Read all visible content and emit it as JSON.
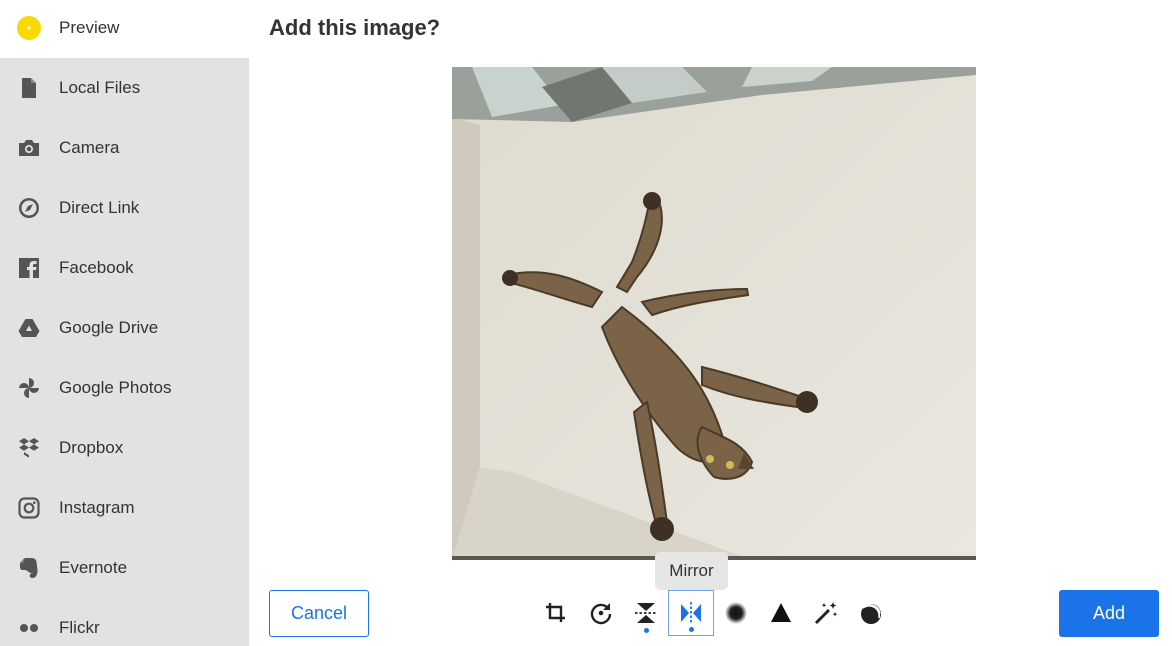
{
  "title": "Add this image?",
  "sidebar": {
    "items": [
      {
        "label": "Preview",
        "icon": "preview-dot-icon",
        "active": true
      },
      {
        "label": "Local Files",
        "icon": "file-icon"
      },
      {
        "label": "Camera",
        "icon": "camera-icon"
      },
      {
        "label": "Direct Link",
        "icon": "link-compass-icon"
      },
      {
        "label": "Facebook",
        "icon": "facebook-icon"
      },
      {
        "label": "Google Drive",
        "icon": "google-drive-icon"
      },
      {
        "label": "Google Photos",
        "icon": "google-photos-icon"
      },
      {
        "label": "Dropbox",
        "icon": "dropbox-icon"
      },
      {
        "label": "Instagram",
        "icon": "instagram-icon"
      },
      {
        "label": "Evernote",
        "icon": "evernote-icon"
      },
      {
        "label": "Flickr",
        "icon": "flickr-icon"
      }
    ]
  },
  "tooltip": "Mirror",
  "buttons": {
    "cancel": "Cancel",
    "add": "Add"
  },
  "tools": [
    {
      "name": "crop",
      "icon": "crop-icon"
    },
    {
      "name": "rotate",
      "icon": "rotate-icon"
    },
    {
      "name": "flip",
      "icon": "flip-vertical-icon",
      "applied": true
    },
    {
      "name": "mirror",
      "icon": "mirror-icon",
      "applied": true,
      "selected": true
    },
    {
      "name": "blur",
      "icon": "blur-icon"
    },
    {
      "name": "sharpen",
      "icon": "sharpen-triangle-icon"
    },
    {
      "name": "enhance",
      "icon": "magic-wand-icon"
    },
    {
      "name": "grayscale",
      "icon": "grayscale-icon"
    }
  ],
  "colors": {
    "accent": "#1a73e8",
    "sidebar_bg": "#e3e2e2",
    "preview_dot": "#f9d900",
    "icon_gray": "#555555"
  }
}
